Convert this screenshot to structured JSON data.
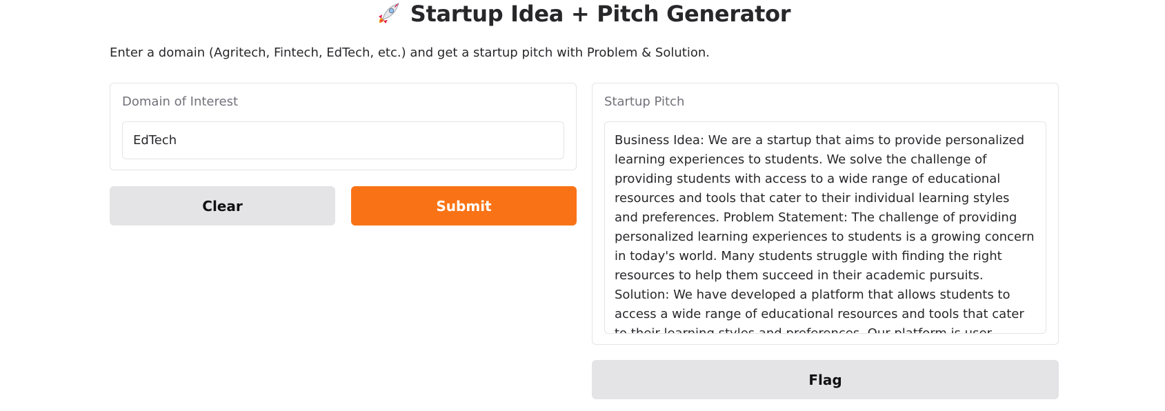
{
  "header": {
    "title": "Startup Idea + Pitch Generator",
    "icon": "rocket-icon"
  },
  "description": "Enter a domain (Agritech, Fintech, EdTech, etc.) and get a startup pitch with Problem & Solution.",
  "input": {
    "label": "Domain of Interest",
    "value": "EdTech"
  },
  "buttons": {
    "clear": "Clear",
    "submit": "Submit",
    "flag": "Flag"
  },
  "output": {
    "label": "Startup Pitch",
    "text": "Business Idea: We are a startup that aims to provide personalized learning experiences to students. We solve the challenge of providing students with access to a wide range of educational resources and tools that cater to their individual learning styles and preferences. Problem Statement: The challenge of providing personalized learning experiences to students is a growing concern in today's world. Many students struggle with finding the right resources to help them succeed in their academic pursuits. Solution: We have developed a platform that allows students to access a wide range of educational resources and tools that cater to their learning styles and preferences. Our platform is user-friendly,"
  },
  "colors": {
    "accent": "#f97316",
    "secondary_button": "#e4e4e7",
    "border": "#e4e4e7",
    "label": "#71717a",
    "text": "#27272a"
  }
}
